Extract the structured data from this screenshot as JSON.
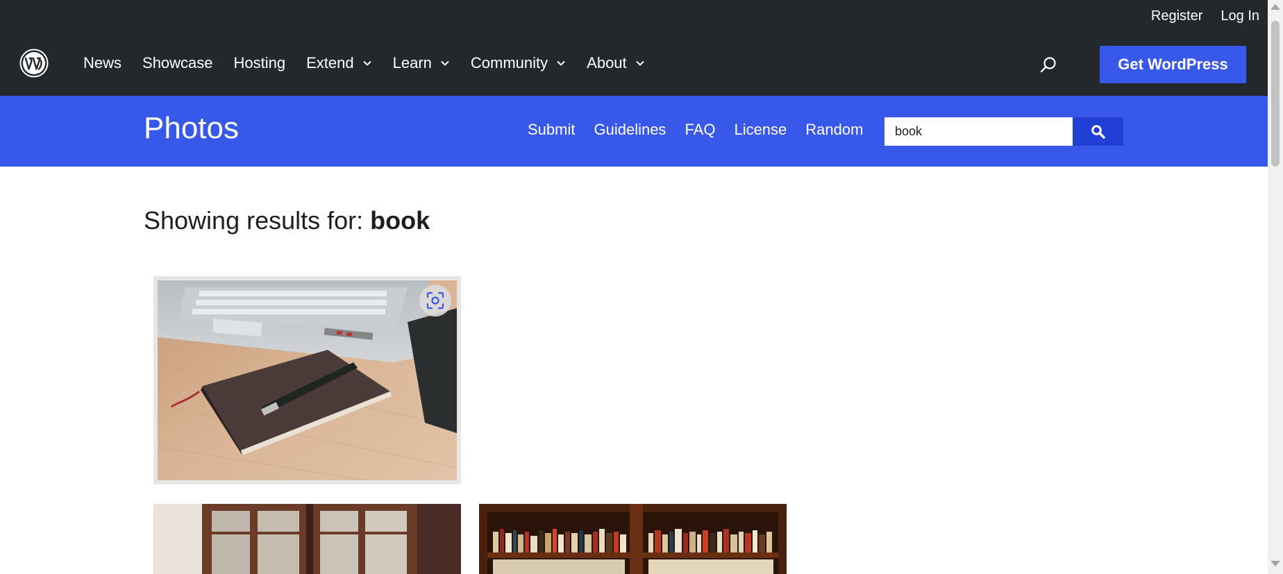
{
  "global_header": {
    "user_links": {
      "register": "Register",
      "login": "Log In"
    },
    "nav": [
      {
        "label": "News",
        "has_dropdown": false
      },
      {
        "label": "Showcase",
        "has_dropdown": false
      },
      {
        "label": "Hosting",
        "has_dropdown": false
      },
      {
        "label": "Extend",
        "has_dropdown": true
      },
      {
        "label": "Learn",
        "has_dropdown": true
      },
      {
        "label": "Community",
        "has_dropdown": true
      },
      {
        "label": "About",
        "has_dropdown": true
      }
    ],
    "cta": "Get WordPress",
    "logo_icon": "wordpress-logo-icon",
    "search_icon": "search-icon"
  },
  "sub_header": {
    "title": "Photos",
    "nav": [
      "Submit",
      "Guidelines",
      "FAQ",
      "License",
      "Random"
    ],
    "search": {
      "value": "book"
    }
  },
  "results": {
    "prefix": "Showing results for: ",
    "query": "book"
  },
  "colors": {
    "header_dark": "#23282d",
    "brand_blue": "#3858e9",
    "search_btn_blue": "#213fd4"
  }
}
